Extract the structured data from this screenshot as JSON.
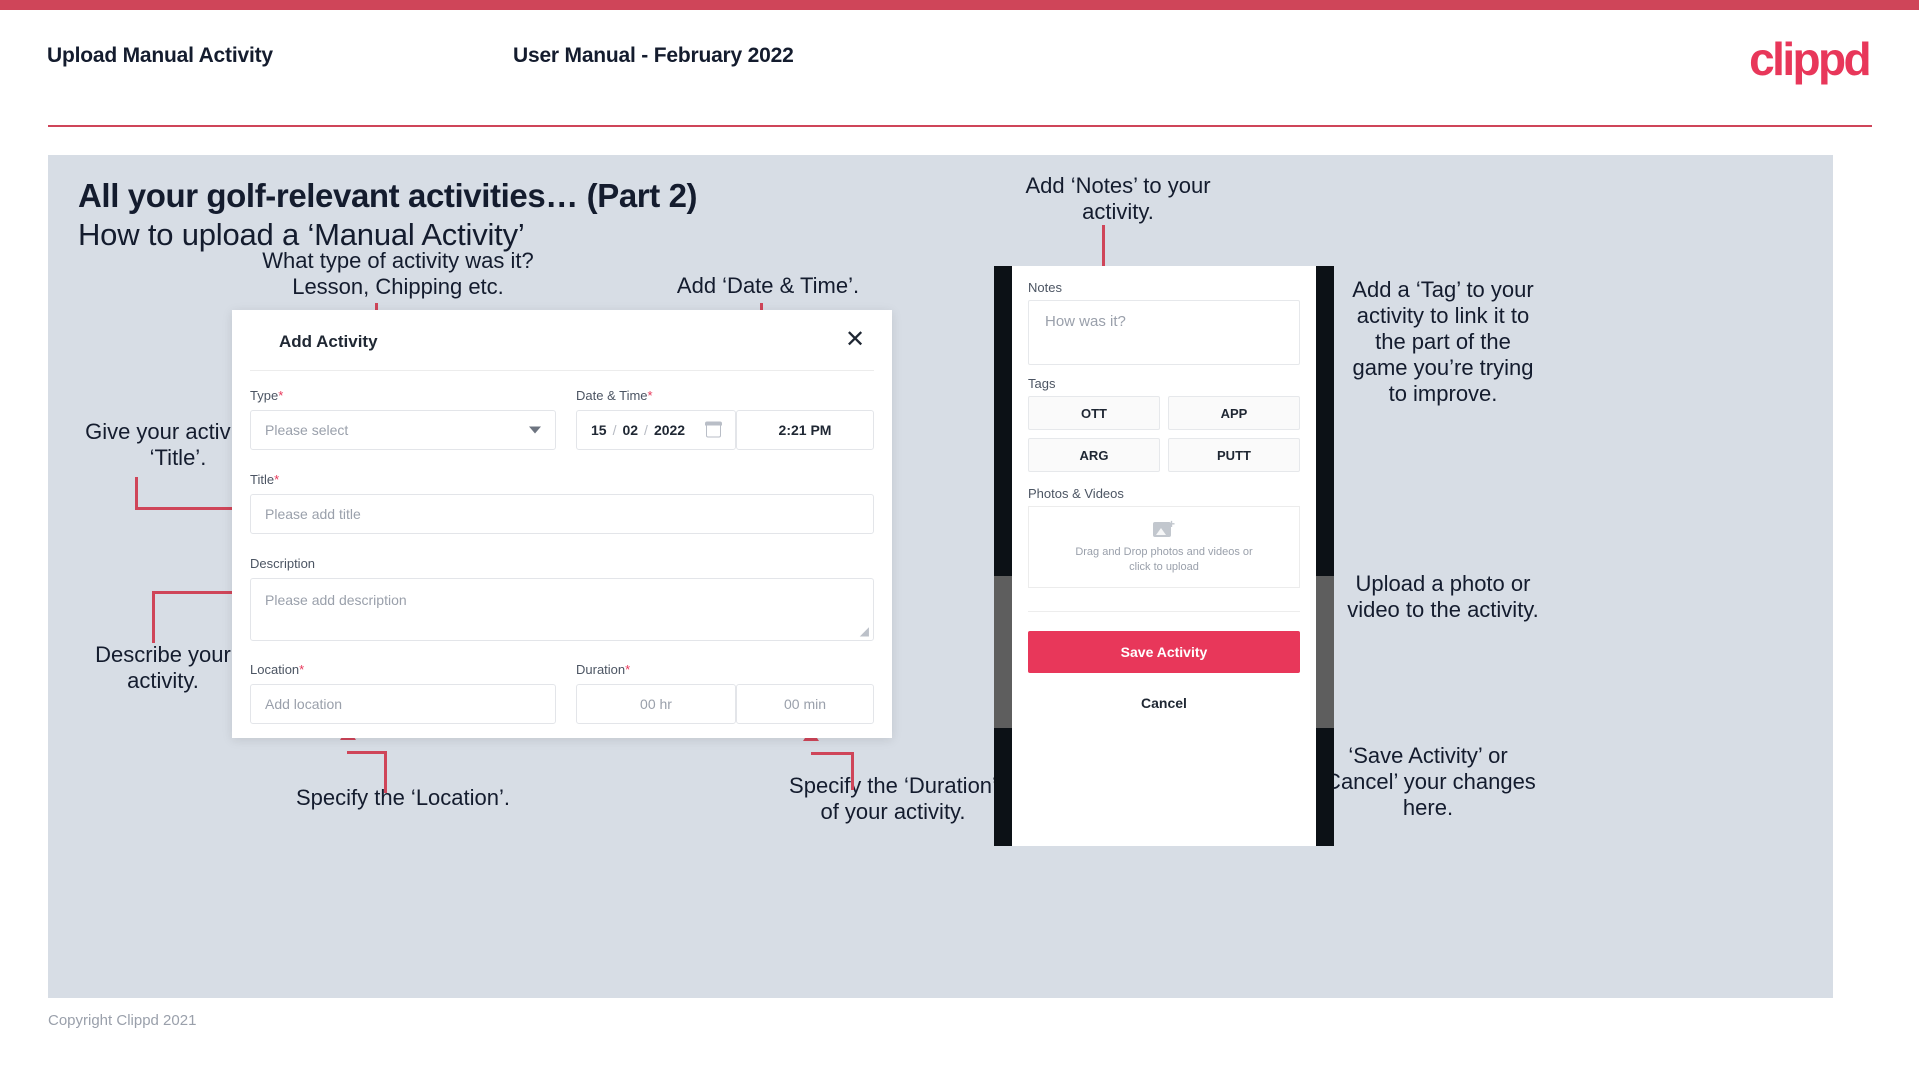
{
  "header": {
    "left_title": "Upload Manual Activity",
    "center_title": "User Manual - February 2022",
    "logo": "clippd"
  },
  "slide": {
    "heading": "All your golf-relevant activities… (Part 2)",
    "subheading": "How to upload a ‘Manual Activity’"
  },
  "annotations": {
    "type": "What type of activity was it?\nLesson, Chipping etc.",
    "datetime": "Add ‘Date & Time’.",
    "title": "Give your activity a\n‘Title’.",
    "description": "Describe your\nactivity.",
    "location": "Specify the ‘Location’.",
    "duration": "Specify the ‘Duration’\nof your activity.",
    "notes": "Add ‘Notes’ to your\nactivity.",
    "tags": "Add a ‘Tag’ to your\nactivity to link it to\nthe part of the\ngame you’re trying\nto improve.",
    "upload": "Upload a photo or\nvideo to the activity.",
    "save_cancel": "‘Save Activity’ or\n‘Cancel’ your changes\nhere."
  },
  "dialog": {
    "title": "Add Activity",
    "close_icon": "✕",
    "fields": {
      "type": {
        "label": "Type",
        "required": "*",
        "placeholder": "Please select"
      },
      "datetime": {
        "label": "Date & Time",
        "required": "*",
        "day": "15",
        "month": "02",
        "year": "2022",
        "sep": "/",
        "time": "2:21 PM"
      },
      "title": {
        "label": "Title",
        "required": "*",
        "placeholder": "Please add title"
      },
      "description": {
        "label": "Description",
        "required": "",
        "placeholder": "Please add description"
      },
      "location": {
        "label": "Location",
        "required": "*",
        "placeholder": "Add location"
      },
      "duration": {
        "label": "Duration",
        "required": "*",
        "hours_placeholder": "00 hr",
        "minutes_placeholder": "00 min"
      }
    }
  },
  "phone": {
    "notes": {
      "label": "Notes",
      "placeholder": "How was it?"
    },
    "tags": {
      "label": "Tags",
      "items": [
        "OTT",
        "APP",
        "ARG",
        "PUTT"
      ]
    },
    "photos": {
      "label": "Photos & Videos",
      "dropzone_line1": "Drag and Drop photos and videos or",
      "dropzone_line2": "click to upload"
    },
    "save_label": "Save Activity",
    "cancel_label": "Cancel"
  },
  "footer": {
    "copyright": "Copyright Clippd 2021"
  },
  "colors": {
    "accent": "#cf4559",
    "brand": "#e8375a",
    "slide_bg": "#d7dde5",
    "ink": "#141c2e"
  }
}
